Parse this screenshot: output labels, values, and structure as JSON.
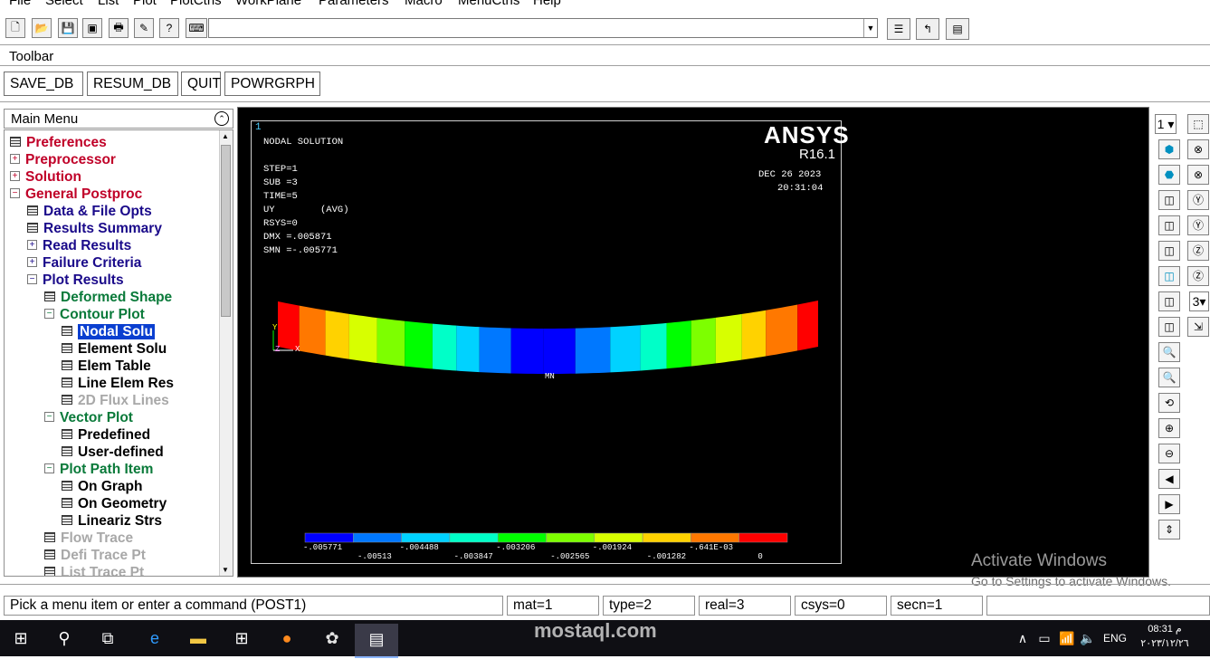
{
  "menubar": {
    "items": [
      "File",
      "Select",
      "List",
      "Plot",
      "PlotCtrls",
      "WorkPlane",
      "Parameters",
      "Macro",
      "MenuCtrls",
      "Help"
    ]
  },
  "toolbar_label": "Toolbar",
  "command_buttons": [
    "SAVE_DB",
    "RESUM_DB",
    "QUIT",
    "POWRGRPH"
  ],
  "main_menu": {
    "title": "Main Menu",
    "items": [
      {
        "label": "Preferences",
        "color": "red",
        "indent": 0,
        "icon": "doc"
      },
      {
        "label": "Preprocessor",
        "color": "red",
        "indent": 0,
        "icon": "plus"
      },
      {
        "label": "Solution",
        "color": "red",
        "indent": 0,
        "icon": "plus"
      },
      {
        "label": "General Postproc",
        "color": "red",
        "indent": 0,
        "icon": "minus"
      },
      {
        "label": "Data & File Opts",
        "color": "blue",
        "indent": 1,
        "icon": "doc"
      },
      {
        "label": "Results Summary",
        "color": "blue",
        "indent": 1,
        "icon": "doc"
      },
      {
        "label": "Read Results",
        "color": "blue",
        "indent": 1,
        "icon": "plus"
      },
      {
        "label": "Failure Criteria",
        "color": "blue",
        "indent": 1,
        "icon": "plus"
      },
      {
        "label": "Plot Results",
        "color": "blue",
        "indent": 1,
        "icon": "minus"
      },
      {
        "label": "Deformed Shape",
        "color": "green",
        "indent": 2,
        "icon": "doc"
      },
      {
        "label": "Contour Plot",
        "color": "green",
        "indent": 2,
        "icon": "minus"
      },
      {
        "label": "Nodal Solu",
        "color": "black",
        "indent": 3,
        "icon": "doc",
        "selected": true
      },
      {
        "label": "Element Solu",
        "color": "black",
        "indent": 3,
        "icon": "doc"
      },
      {
        "label": "Elem Table",
        "color": "black",
        "indent": 3,
        "icon": "doc"
      },
      {
        "label": "Line Elem Res",
        "color": "black",
        "indent": 3,
        "icon": "doc"
      },
      {
        "label": "2D Flux Lines",
        "color": "gray",
        "indent": 3,
        "icon": "doc"
      },
      {
        "label": "Vector Plot",
        "color": "green",
        "indent": 2,
        "icon": "minus"
      },
      {
        "label": "Predefined",
        "color": "black",
        "indent": 3,
        "icon": "doc"
      },
      {
        "label": "User-defined",
        "color": "black",
        "indent": 3,
        "icon": "doc"
      },
      {
        "label": "Plot Path Item",
        "color": "green",
        "indent": 2,
        "icon": "minus"
      },
      {
        "label": "On Graph",
        "color": "black",
        "indent": 3,
        "icon": "doc"
      },
      {
        "label": "On Geometry",
        "color": "black",
        "indent": 3,
        "icon": "doc"
      },
      {
        "label": "Lineariz Strs",
        "color": "black",
        "indent": 3,
        "icon": "doc"
      },
      {
        "label": "Flow Trace",
        "color": "gray",
        "indent": 2,
        "icon": "doc"
      },
      {
        "label": "Defi Trace Pt",
        "color": "gray",
        "indent": 2,
        "icon": "doc"
      },
      {
        "label": "List Trace Pt",
        "color": "gray",
        "indent": 2,
        "icon": "doc"
      }
    ]
  },
  "graphics": {
    "window_number": "1",
    "header_lines": [
      "NODAL SOLUTION",
      "",
      "STEP=1",
      "SUB =3",
      "TIME=5",
      "UY        (AVG)",
      "RSYS=0",
      "DMX =.005871",
      "SMN =-.005771"
    ],
    "logo": "ANSYS",
    "version": "R16.1",
    "date": "DEC 26 2023",
    "time": "20:31:04",
    "mn_label": "MN",
    "axis_labels": {
      "y": "Y",
      "z": "Z",
      "x": "X"
    },
    "legend_colors": [
      "#0000ff",
      "#0078ff",
      "#00d2ff",
      "#00ffc8",
      "#00ff00",
      "#7dff00",
      "#d7ff00",
      "#ffd200",
      "#ff7800",
      "#ff0000"
    ],
    "legend_top": [
      "-.005771",
      "-.004488",
      "-.003206",
      "-.001924",
      "-.641E-03"
    ],
    "legend_bottom": [
      "-.00513",
      "-.003847",
      "-.002565",
      "-.001282",
      "0"
    ]
  },
  "right_panel": {
    "view_select": "1",
    "zoom_select": "3"
  },
  "watermark": {
    "line1": "Activate Windows",
    "line2": "Go to Settings to activate Windows."
  },
  "status": {
    "prompt": "Pick a menu item or enter a command (POST1)",
    "mat": "mat=1",
    "type": "type=2",
    "real": "real=3",
    "csys": "csys=0",
    "secn": "secn=1"
  },
  "taskbar": {
    "language": "ENG",
    "clock_time": "08:31 م",
    "clock_date": "٢٠٢٣/١٢/٢٦"
  },
  "site_watermark": "mostaql.com"
}
